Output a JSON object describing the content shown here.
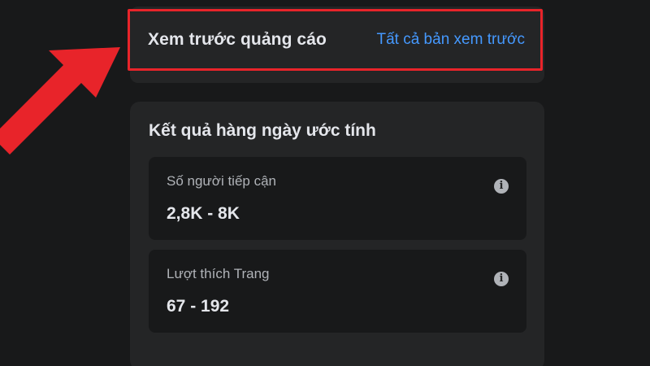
{
  "preview": {
    "title": "Xem trước quảng cáo",
    "link": "Tất cả bản xem trước"
  },
  "results": {
    "title": "Kết quả hàng ngày ước tính",
    "metrics": [
      {
        "label": "Số người tiếp cận",
        "value": "2,8K - 8K",
        "icon": "info-icon"
      },
      {
        "label": "Lượt thích Trang",
        "value": "67 - 192",
        "icon": "info-icon"
      }
    ]
  },
  "annotation": {
    "highlight_color": "#e8242a"
  },
  "colors": {
    "background": "#18191a",
    "card": "#242526",
    "link": "#4599ff",
    "text_primary": "#e4e6eb",
    "text_secondary": "#b0b3b8"
  }
}
